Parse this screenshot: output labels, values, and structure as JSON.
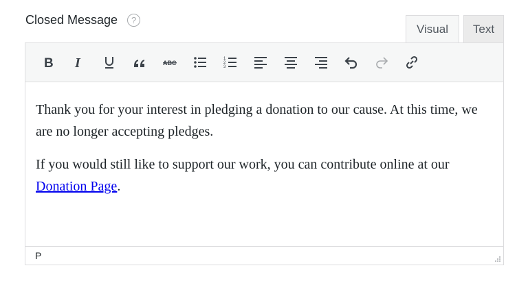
{
  "field": {
    "label": "Closed Message",
    "help": "?"
  },
  "tabs": [
    {
      "label": "Visual",
      "active": true
    },
    {
      "label": "Text",
      "active": false
    }
  ],
  "toolbar": {
    "buttons": [
      {
        "name": "bold-icon"
      },
      {
        "name": "italic-icon"
      },
      {
        "name": "underline-icon"
      },
      {
        "name": "blockquote-icon"
      },
      {
        "name": "strikethrough-icon"
      },
      {
        "name": "bullet-list-icon"
      },
      {
        "name": "numbered-list-icon"
      },
      {
        "name": "align-left-icon"
      },
      {
        "name": "align-center-icon"
      },
      {
        "name": "align-right-icon"
      },
      {
        "name": "undo-icon"
      },
      {
        "name": "redo-icon",
        "disabled": true
      },
      {
        "name": "link-icon"
      }
    ]
  },
  "content": {
    "paragraph1": "Thank you for your interest in pledging a donation to our cause. At this time, we are no longer accepting pledges.",
    "paragraph2_before": "If you would still like to support our work, you can contribute online at our ",
    "paragraph2_link": "Donation Page",
    "paragraph2_after": "."
  },
  "statusbar": {
    "path": "P"
  },
  "colors": {
    "toolbar_bg": "#f6f7f7",
    "border": "#dcdcde",
    "link": "#0000ee",
    "icon": "#3c434a",
    "icon_disabled": "#a7aaad"
  }
}
